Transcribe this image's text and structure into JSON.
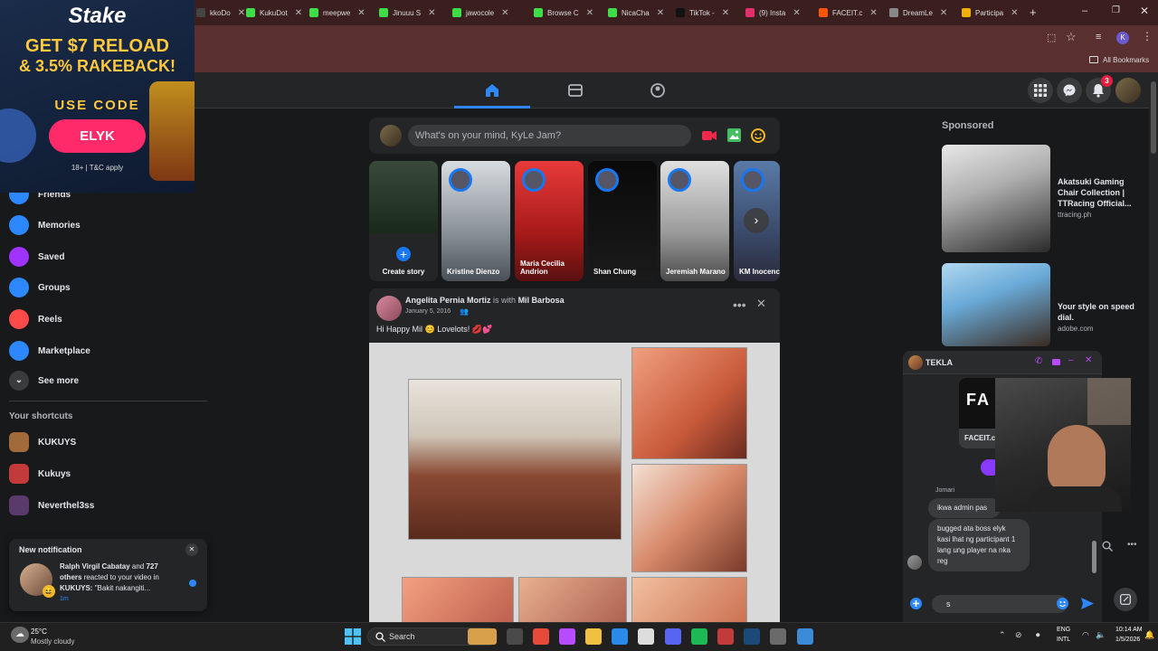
{
  "browser": {
    "tabs": [
      {
        "label": "kkoDo",
        "color": "#444"
      },
      {
        "label": "KukuDot",
        "color": "#3ddc48"
      },
      {
        "label": "meepwe",
        "color": "#3ddc48"
      },
      {
        "label": "Jinuuu S",
        "color": "#3ddc48"
      },
      {
        "label": "jawocole",
        "color": "#3ddc48"
      },
      {
        "label": "Browse C",
        "color": "#3ddc48"
      },
      {
        "label": "NicaCha",
        "color": "#3ddc48"
      },
      {
        "label": "TikTok -",
        "color": "#111"
      },
      {
        "label": "(9) Insta",
        "color": "#e1306c"
      },
      {
        "label": "FACEIT.c",
        "color": "#ff5500"
      },
      {
        "label": "DreamLe",
        "color": "#888"
      },
      {
        "label": "Participa",
        "color": "#f0b000"
      }
    ],
    "new_tab": "+",
    "bookmarks_label": "All Bookmarks",
    "profile_initial": "K"
  },
  "ad": {
    "brand": "Stake",
    "line1": "GET $7 RELOAD",
    "line2": "& 3.5% RAKEBACK!",
    "use_code": "USE CODE",
    "code": "ELYK",
    "disclaimer": "18+ | T&C apply"
  },
  "header": {
    "notif_count": "3"
  },
  "sidebar": {
    "partial_item": "Friends",
    "items": [
      {
        "label": "Memories",
        "color": "#2d88ff"
      },
      {
        "label": "Saved",
        "color": "#a033ff"
      },
      {
        "label": "Groups",
        "color": "#2d88ff"
      },
      {
        "label": "Reels",
        "color": "#ff4a4a"
      },
      {
        "label": "Marketplace",
        "color": "#2d88ff"
      }
    ],
    "see_more": "See more",
    "shortcuts_title": "Your shortcuts",
    "shortcuts": [
      {
        "label": "KUKUYS"
      },
      {
        "label": "Kukuys"
      },
      {
        "label": "Neverthel3ss"
      }
    ]
  },
  "composer": {
    "placeholder": "What's on your mind, KyLe Jam?"
  },
  "stories": [
    {
      "name": "Create story"
    },
    {
      "name": "Kristine Dienzo"
    },
    {
      "name": "Maria Cecilia Andrion"
    },
    {
      "name": "Shan Chung"
    },
    {
      "name": "Jeremiah Marano"
    },
    {
      "name": "KM Inocenci"
    }
  ],
  "post": {
    "author": "Angelita Pernia Mortiz",
    "with_text": "is with",
    "tagged": "Mil Barbosa",
    "date": "January 5, 2016",
    "caption": "Hi Happy Mil 😊 Lovelots! 💋💕"
  },
  "sponsored": {
    "title": "Sponsored",
    "ads": [
      {
        "title": "Akatsuki Gaming Chair Collection | TTRacing Official...",
        "url": "ttracing.ph"
      },
      {
        "title": "Your style on speed dial.",
        "url": "adobe.com"
      }
    ]
  },
  "chat": {
    "name": "TEKLA",
    "faceit_label": "FACEIT.c",
    "sender": "Jomari",
    "msg1": "ikwa admin pas",
    "msg2": "bugged ata boss elyk kasi lhat ng participant 1 lang ung player na nka reg",
    "input_value": "s"
  },
  "notification": {
    "title": "New notification",
    "actor": "Ralph Virgil Cabatay",
    "and_text": "and",
    "count": "727",
    "others": "others",
    "body": "reacted to your video in",
    "group": "KUKUYS:",
    "quote": "\"Bakit nakangiti...",
    "time": "1m"
  },
  "taskbar": {
    "weather_temp": "25°C",
    "weather_desc": "Mostly cloudy",
    "search": "Search",
    "lang1": "ENG",
    "lang2": "INTL",
    "time": "10:14 AM",
    "date": "1/5/2026"
  }
}
